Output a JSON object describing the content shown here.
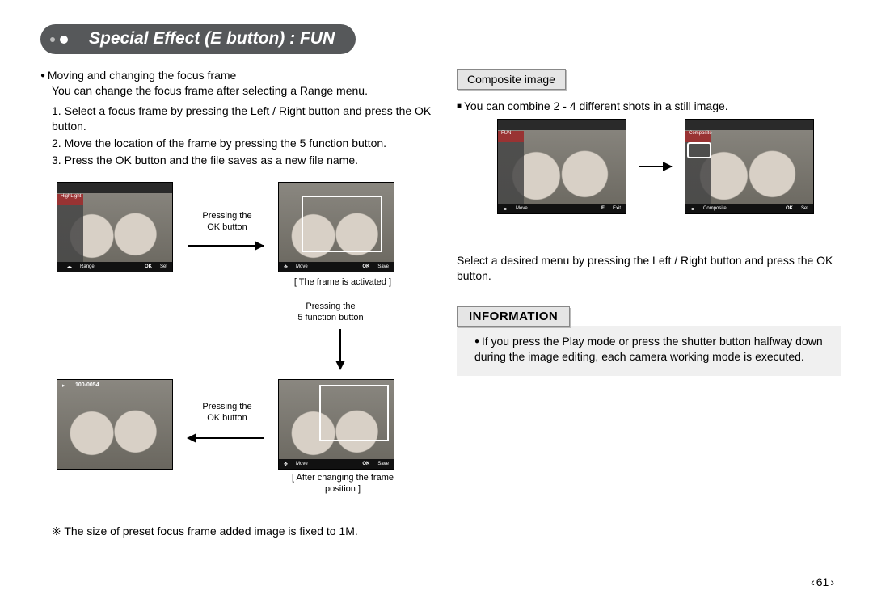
{
  "title": "Special Effect (E button) :  FUN",
  "left": {
    "heading": "Moving and changing the focus frame",
    "desc": "You can change the focus frame after selecting a Range menu.",
    "steps": [
      "1. Select a focus frame by pressing the Left / Right button and press the OK button.",
      "2. Move the location of the frame by pressing the 5 function button.",
      "3. Press the OK button and the file saves as a new file name."
    ],
    "shot1": {
      "label": "HighLight",
      "bar_left": "Range",
      "bar_mid": "OK",
      "bar_right": "Set"
    },
    "cap_ok1": "Pressing the\nOK button",
    "shot2": {
      "bar_left": "Move",
      "bar_mid": "OK",
      "bar_right": "Save",
      "caption": "[ The frame is activated ]"
    },
    "cap_5fn": "Pressing the\n5 function button",
    "shot3": {
      "counter": "100-0054"
    },
    "cap_ok2": "Pressing the\nOK button",
    "shot4": {
      "bar_left": "Move",
      "bar_mid": "OK",
      "bar_right": "Save",
      "caption": "[ After changing the frame\nposition ]"
    },
    "note": "The size of preset focus frame added image is fixed to 1M."
  },
  "right": {
    "section_label": "Composite image",
    "line": "You can combine 2 - 4 different shots in a still image.",
    "rshot1": {
      "topleft": "FUN",
      "bar_left": "Move",
      "bar_mid": "E",
      "bar_right": "Exit"
    },
    "rshot2": {
      "topleft": "Composite",
      "bar_left": "Composite",
      "bar_mid": "OK",
      "bar_right": "Set"
    },
    "after": "Select a desired menu by pressing the Left / Right button and press the OK button.",
    "info_head": "INFORMATION",
    "info_body": "If you press the Play mode or press the shutter button halfway down during the image editing, each camera working mode is executed."
  },
  "page_number": "61"
}
